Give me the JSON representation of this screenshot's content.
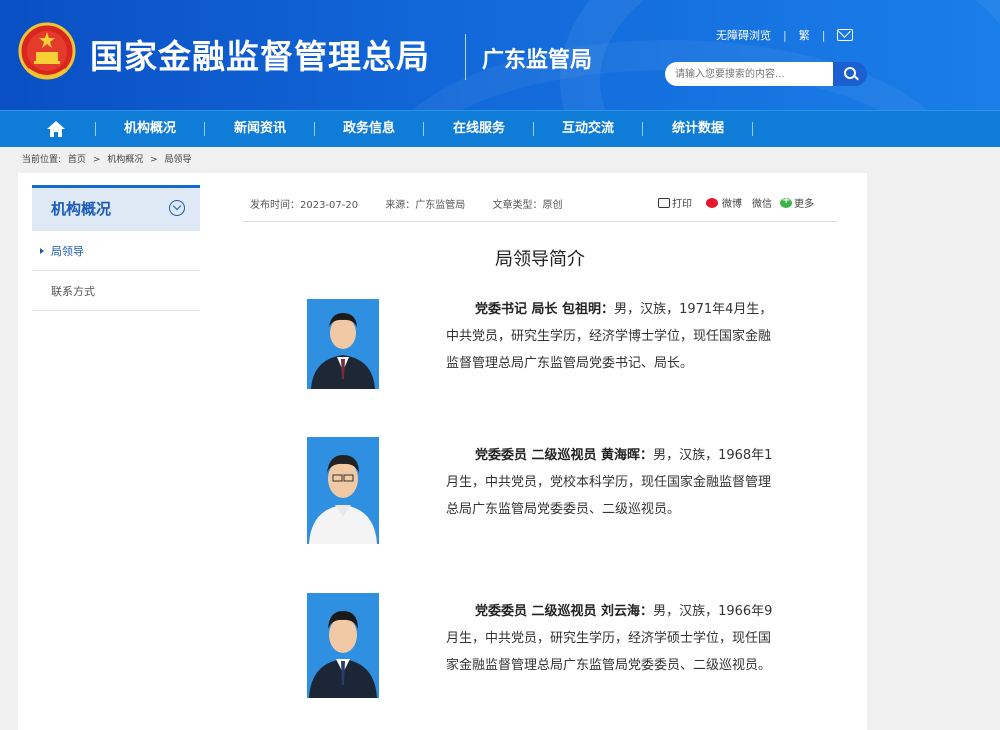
{
  "header": {
    "site_title": "国家金融监督管理总局",
    "branch_title": "广东监管局",
    "links": [
      "无障碍浏览",
      "繁"
    ],
    "search_placeholder": "请输入您要搜索的内容..."
  },
  "nav": {
    "items": [
      "机构概况",
      "新闻资讯",
      "政务信息",
      "在线服务",
      "互动交流",
      "统计数据"
    ]
  },
  "breadcrumb": [
    "当前位置:",
    "首页",
    ">",
    "机构概况",
    ">",
    "局领导"
  ],
  "sidebar": {
    "title": "机构概况",
    "items": [
      "局领导",
      "联系方式"
    ]
  },
  "article": {
    "publish_label": "发布时间：2023-07-20",
    "source_label": "来源：广东监管局",
    "type_label": "文章类型：原创",
    "share": [
      "打印",
      "微博",
      "微信",
      "更多"
    ],
    "title": "局领导简介"
  },
  "leaders": [
    {
      "title": "党委书记 局长 包祖明：",
      "bio": "男，汉族，1971年4月生，中共党员，研究生学历，经济学博士学位，现任国家金融监督管理总局广东监管局党委书记、局长。"
    },
    {
      "title": "党委委员 二级巡视员 黄海晖：",
      "bio": "男，汉族，1968年1月生，中共党员，党校本科学历，现任国家金融监督管理总局广东监管局党委委员、二级巡视员。"
    },
    {
      "title": "党委委员 二级巡视员 刘云海：",
      "bio": "男，汉族，1966年9月生，中共党员，研究生学历，经济学硕士学位，现任国家金融监督管理总局广东监管局党委委员、二级巡视员。"
    }
  ],
  "colors": {
    "header_blue": "#1268d9",
    "nav_blue": "#0f7cd8",
    "link_blue": "#1a5bb8",
    "photo_bg": "#2f8fe0"
  }
}
